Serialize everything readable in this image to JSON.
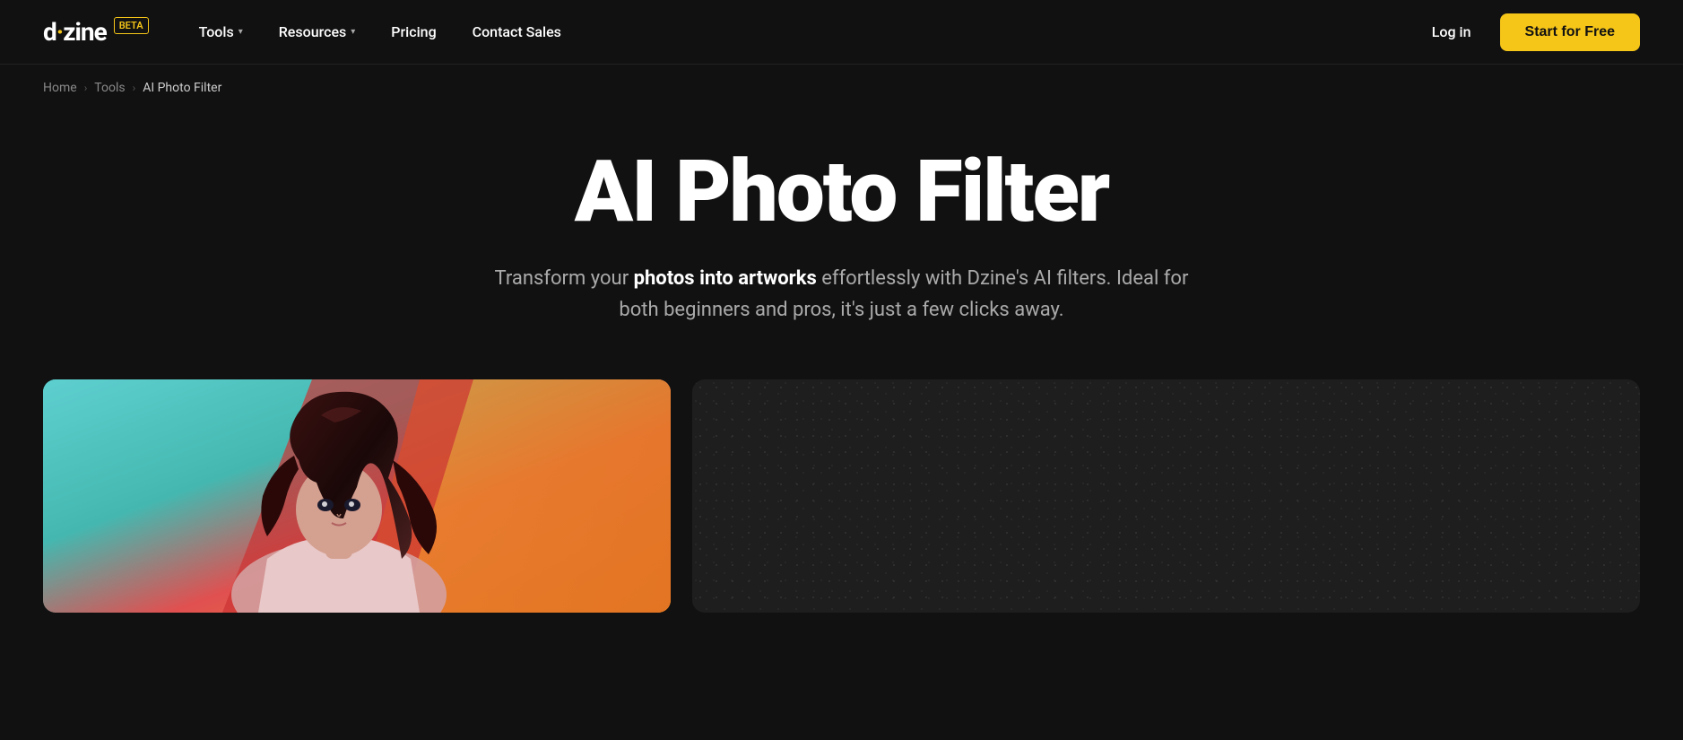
{
  "brand": {
    "name": "dzine",
    "name_dot": "d",
    "name_rest": "zine",
    "beta_label": "BETA"
  },
  "navbar": {
    "tools_label": "Tools",
    "resources_label": "Resources",
    "pricing_label": "Pricing",
    "contact_sales_label": "Contact Sales",
    "login_label": "Log in",
    "start_label": "Start for Free"
  },
  "breadcrumb": {
    "home": "Home",
    "tools": "Tools",
    "current": "AI Photo Filter"
  },
  "hero": {
    "title": "AI Photo Filter",
    "subtitle_normal": "Transform your ",
    "subtitle_bold": "photos into artworks",
    "subtitle_end": " effortlessly with Dzine's AI filters. Ideal for both beginners and pros, it's just a few clicks away."
  },
  "colors": {
    "background": "#111111",
    "accent": "#f5c518",
    "text_primary": "#ffffff",
    "text_secondary": "#aaaaaa",
    "card_dark": "#1e1e1e"
  }
}
